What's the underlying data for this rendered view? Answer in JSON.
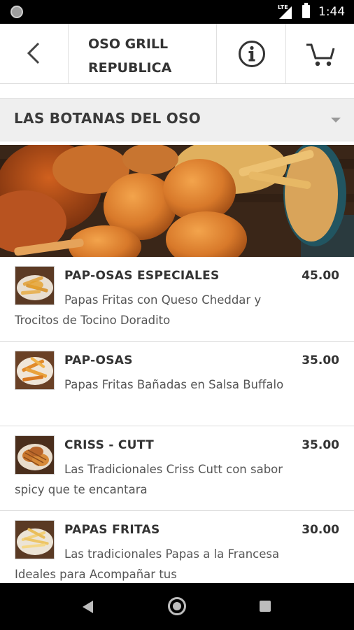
{
  "status_bar": {
    "network": "LTE",
    "time": "1:44"
  },
  "header": {
    "title_line1": "OSO GRILL",
    "title_line2": "REPUBLICA",
    "back_icon": "chevron-left-icon",
    "info_icon": "info-circle-icon",
    "cart_icon": "cart-icon"
  },
  "category": {
    "label": "LAS BOTANAS DEL OSO",
    "dropdown_icon": "caret-down-icon"
  },
  "menu_items": [
    {
      "name": "PAP-OSAS ESPECIALES",
      "price": "45.00",
      "description": "Papas Fritas con Queso Cheddar y Trocitos de Tocino Doradito"
    },
    {
      "name": "PAP-OSAS",
      "price": "35.00",
      "description": "Papas Fritas Bañadas en Salsa Buffalo"
    },
    {
      "name": "CRISS - CUTT",
      "price": "35.00",
      "description": "Las Tradicionales Criss Cutt con sabor spicy que te encantara"
    },
    {
      "name": "PAPAS FRITAS",
      "price": "30.00",
      "description": "Las tradicionales Papas a la Francesa Ideales para Acompañar tus"
    }
  ],
  "colors": {
    "category_bg": "#efefef",
    "text": "#333333",
    "status_bar": "#000000"
  }
}
